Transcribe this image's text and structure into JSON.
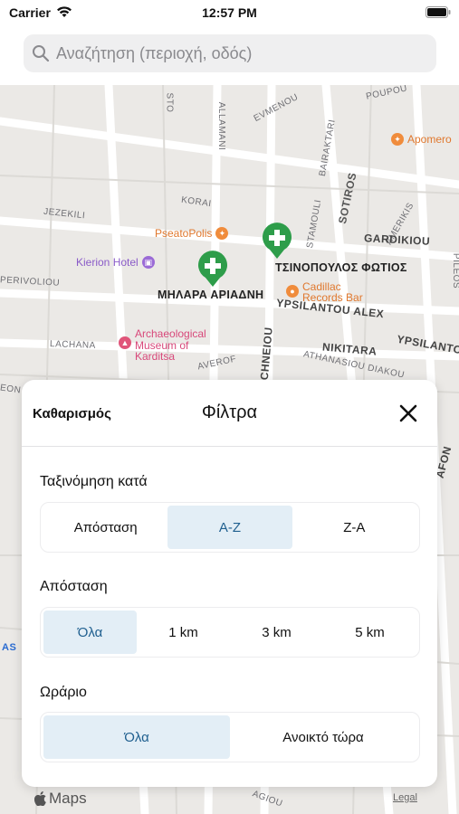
{
  "status_bar": {
    "carrier": "Carrier",
    "time": "12:57 PM"
  },
  "search": {
    "placeholder": "Αναζήτηση (περιοχή, οδός)"
  },
  "map": {
    "streets": [
      "ALLAMANI",
      "EVMENOU",
      "POUPOU",
      "BAIRAKTARI",
      "SOTIROS",
      "KORAI",
      "JEZEKILI",
      "STAMOULI",
      "AMERIKIS",
      "GARDIKIOU",
      "PILEOS",
      "PERIVOLIOU",
      "YPSILANTOU ALEX",
      "NIKITARA",
      "YPSILANTO",
      "LACHANA",
      "TECHNEIOU",
      "AVEROF",
      "ATHANASIOU DIAKOU",
      "EON",
      "AFON",
      "AGIOU",
      "STO",
      "AS"
    ],
    "pois": [
      {
        "name": "Apomero",
        "color": "#f08c3c"
      },
      {
        "name": "PseatoPolis",
        "color": "#f08c3c"
      },
      {
        "name": "Kierion Hotel",
        "color": "#9b6bd6"
      },
      {
        "name": "Cadillac\nRecords Bar",
        "color": "#f08c3c"
      },
      {
        "name": "Archaeological\nMuseum of\nKarditsa",
        "color": "#e0557a"
      }
    ],
    "pharmacies": [
      {
        "name": "ΤΣΙΝΟΠΟΥΛΟΣ ΦΩΤΙΟΣ"
      },
      {
        "name": "ΜΗΛΑΡΑ ΑΡΙΑΔΝΗ"
      }
    ],
    "maps_logo": "Maps",
    "legal": "Legal",
    "pin_color": "#2e9d4a"
  },
  "filters": {
    "clear_label": "Καθαρισμός",
    "title": "Φίλτρα",
    "sort": {
      "label": "Ταξινόμηση κατά",
      "options": [
        "Απόσταση",
        "A-Z",
        "Z-A"
      ],
      "selected": "A-Z"
    },
    "distance": {
      "label": "Απόσταση",
      "options": [
        "Όλα",
        "1 km",
        "3 km",
        "5 km"
      ],
      "selected": "Όλα"
    },
    "hours": {
      "label": "Ωράριο",
      "options": [
        "Όλα",
        "Ανοικτό τώρα"
      ],
      "selected": "Όλα"
    },
    "active_bg": "#e3eef6",
    "active_text": "#1f5f8f"
  }
}
